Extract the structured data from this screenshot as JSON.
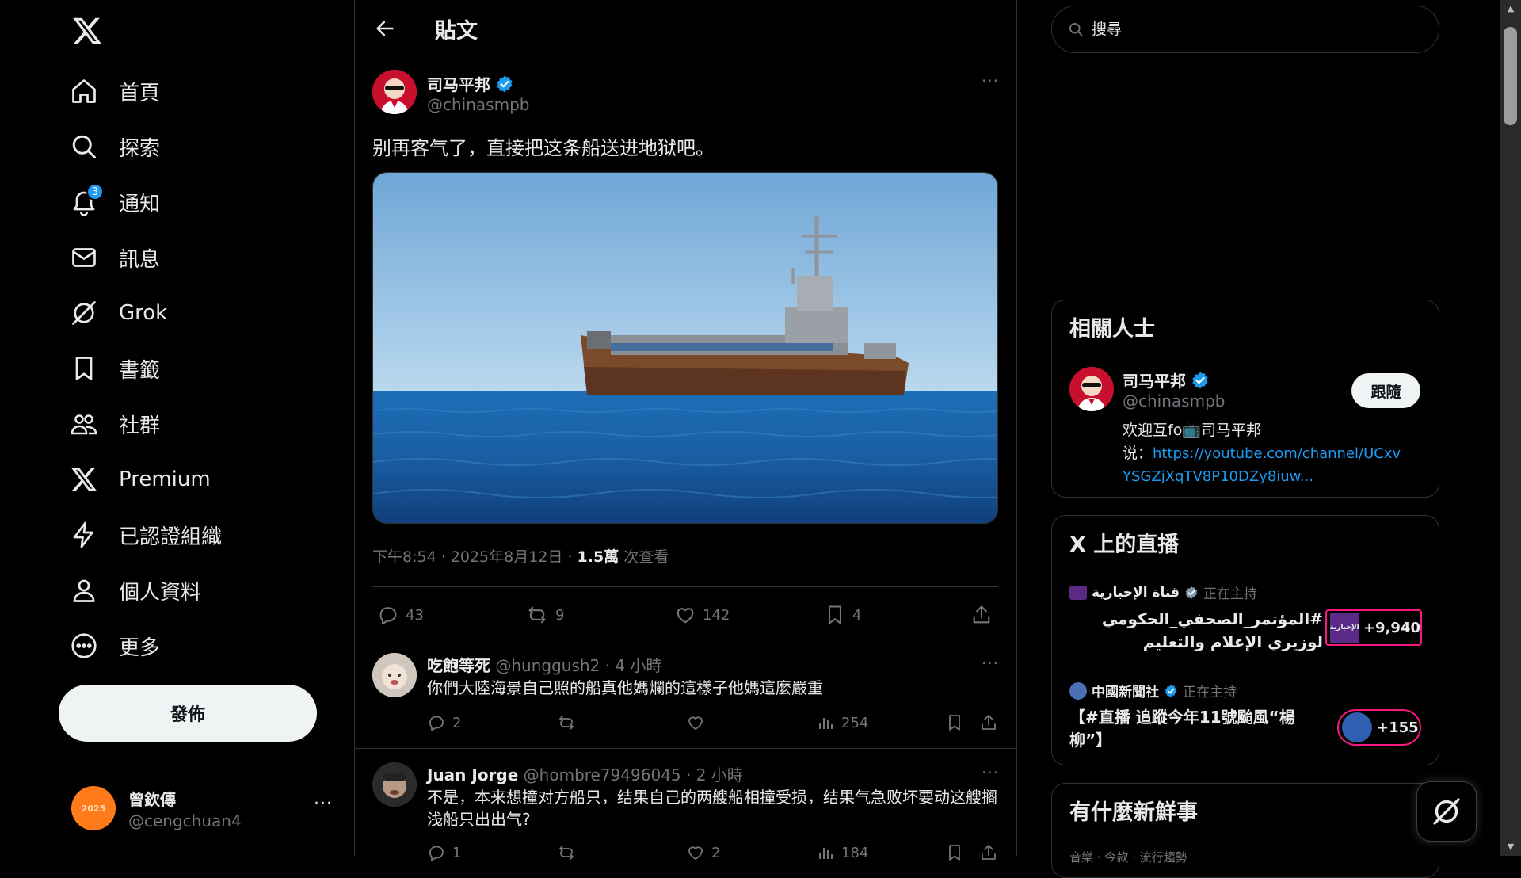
{
  "nav": {
    "items": [
      {
        "label": "首頁"
      },
      {
        "label": "探索"
      },
      {
        "label": "通知",
        "badge": "3"
      },
      {
        "label": "訊息"
      },
      {
        "label": "Grok"
      },
      {
        "label": "書籤"
      },
      {
        "label": "社群"
      },
      {
        "label": "Premium"
      },
      {
        "label": "已認證組織"
      },
      {
        "label": "個人資料"
      },
      {
        "label": "更多"
      }
    ],
    "post_button": "發佈",
    "account": {
      "name": "曾欽傳",
      "handle": "@cengchuan4",
      "avatar_text": "2025"
    }
  },
  "main": {
    "title": "貼文",
    "tweet": {
      "author_name": "司马平邦",
      "author_handle": "@chinasmpb",
      "text": "别再客气了，直接把这条船送进地狱吧。",
      "time": "下午8:54 · 2025年8月12日 · ",
      "views_count": "1.5萬",
      "views_label": " 次查看",
      "replies": "43",
      "reposts": "9",
      "likes": "142",
      "bookmarks": "4"
    },
    "replies": [
      {
        "name": "吃飽等死",
        "handle": "@hunggush2",
        "time": " · 4 小時",
        "text": "你們大陸海景自己照的船真他媽爛的這樣子他媽這麼嚴重",
        "replies": "2",
        "reposts": "",
        "likes": "",
        "views": "254"
      },
      {
        "name": "Juan Jorge",
        "handle": "@hombre79496045",
        "time": " · 2 小時",
        "text": "不是，本来想撞对方船只，结果自己的两艘船相撞受损，结果气急败坏要动这艘搁浅船只出出气?",
        "replies": "1",
        "reposts": "",
        "likes": "2",
        "views": "184"
      }
    ]
  },
  "right": {
    "search_placeholder": "搜尋",
    "related": {
      "title": "相關人士",
      "name": "司马平邦",
      "handle": "@chinasmpb",
      "follow": "跟隨",
      "bio_line1": "欢迎互fo📺司马平邦",
      "bio_line2_prefix": "说：",
      "bio_link_1": "https://youtube.com/channel/UCxv",
      "bio_link_2": "YSGZjXqTV8P10DZy8iuw..."
    },
    "live": {
      "title": "X 上的直播",
      "items": [
        {
          "host": "قناة الإخبارية",
          "status": "正在主持",
          "title": "#المؤتمر_الصحفي_الحكومي لوزيري الإعلام والتعليم",
          "count": "+9,940",
          "pill_icon_text": "الإخبارية"
        },
        {
          "host": "中國新聞社",
          "status": "正在主持",
          "title": "【#直播 追蹤今年11號颱風“楊柳”】",
          "count": "+155"
        }
      ]
    },
    "whats_new": {
      "title": "有什麼新鮮事",
      "sub": "音樂 · 今款 · 流行趨勢"
    }
  },
  "colors": {
    "accent": "#1d9bf0",
    "bg": "#000000",
    "border": "#2f3336",
    "muted": "#71767b",
    "live_pink": "#f91880"
  }
}
